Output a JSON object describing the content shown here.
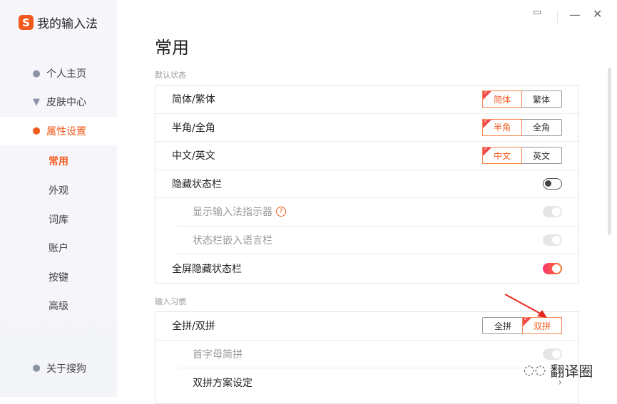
{
  "app": {
    "logo_letter": "S",
    "name": "我的输入法"
  },
  "sidebar": {
    "items": [
      {
        "label": "个人主页",
        "icon": "user-icon"
      },
      {
        "label": "皮肤中心",
        "icon": "shirt-icon"
      },
      {
        "label": "属性设置",
        "icon": "settings-icon"
      }
    ],
    "subitems": [
      "常用",
      "外观",
      "词库",
      "账户",
      "按键",
      "高级"
    ],
    "about": "关于搜狗"
  },
  "window": {
    "feedback": "feedback-icon",
    "minimize": "minimize-icon",
    "close": "close-icon"
  },
  "page": {
    "title": "常用"
  },
  "sections": [
    {
      "label": "默认状态",
      "rows": [
        {
          "label": "简体/繁体",
          "options": [
            "简体",
            "繁体"
          ]
        },
        {
          "label": "半角/全角",
          "options": [
            "半角",
            "全角"
          ]
        },
        {
          "label": "中文/英文",
          "options": [
            "中文",
            "英文"
          ]
        },
        {
          "label": "隐藏状态栏"
        },
        {
          "label": "显示输入法指示器",
          "help": "?"
        },
        {
          "label": "状态栏嵌入语言栏"
        },
        {
          "label": "全屏隐藏状态栏"
        }
      ]
    },
    {
      "label": "输入习惯",
      "rows": [
        {
          "label": "全拼/双拼",
          "options": [
            "全拼",
            "双拼"
          ]
        },
        {
          "label": "首字母简拼"
        },
        {
          "label": "双拼方案设定"
        }
      ]
    }
  ],
  "watermark": "翻译圈",
  "colors": {
    "accent": "#f25a1c"
  }
}
